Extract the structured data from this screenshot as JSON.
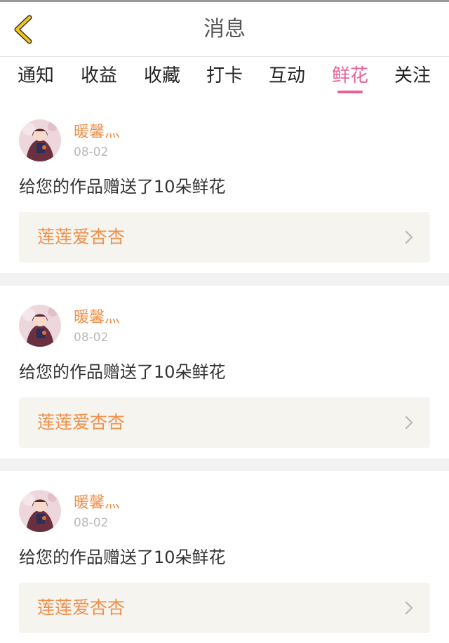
{
  "header": {
    "title": "消息",
    "back_icon": "chevron-left-icon",
    "back_color": "#f5c518"
  },
  "tabs": [
    {
      "label": "通知",
      "active": false
    },
    {
      "label": "收益",
      "active": false
    },
    {
      "label": "收藏",
      "active": false
    },
    {
      "label": "打卡",
      "active": false
    },
    {
      "label": "互动",
      "active": false
    },
    {
      "label": "鲜花",
      "active": true
    },
    {
      "label": "关注",
      "active": false
    }
  ],
  "colors": {
    "accent_pink": "#e8629a",
    "accent_orange": "#f0904a",
    "card_bg": "#f5f4ef",
    "divider": "#f2f2f2"
  },
  "messages": [
    {
      "user_name": "暖馨灬",
      "date": "08-02",
      "text": "给您的作品赠送了10朵鲜花",
      "work_title": "莲莲爱杏杏"
    },
    {
      "user_name": "暖馨灬",
      "date": "08-02",
      "text": "给您的作品赠送了10朵鲜花",
      "work_title": "莲莲爱杏杏"
    },
    {
      "user_name": "暖馨灬",
      "date": "08-02",
      "text": "给您的作品赠送了10朵鲜花",
      "work_title": "莲莲爱杏杏"
    }
  ]
}
